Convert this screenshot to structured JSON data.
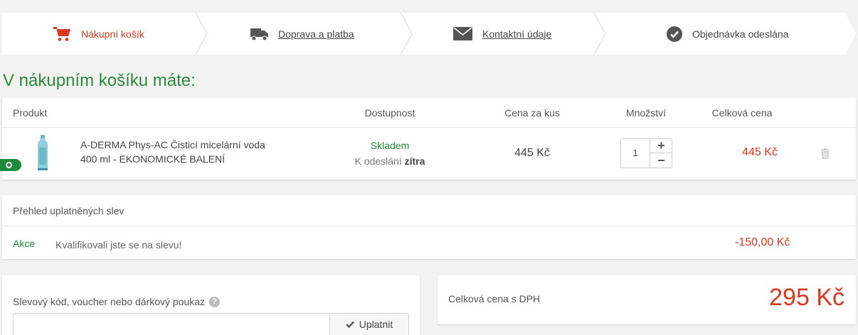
{
  "steps": [
    {
      "label": "Nákupní košík",
      "icon": "cart-icon",
      "active": true
    },
    {
      "label": "Doprava a platba",
      "icon": "truck-icon",
      "active": false
    },
    {
      "label": "Kontaktní údaje",
      "icon": "envelope-icon",
      "active": false
    },
    {
      "label": "Objednávka odeslána",
      "icon": "check-circle-icon",
      "active": false
    }
  ],
  "page_title": "V nákupním košíku máte:",
  "cart": {
    "headers": {
      "product": "Produkt",
      "availability": "Dostupnost",
      "unit_price": "Cena za kus",
      "quantity": "Množství",
      "total": "Celková cena"
    },
    "items": [
      {
        "name": "A-DERMA Phys-AC Čisticí micelární voda 400 ml - EKONOMICKÉ BALENÍ",
        "stock": "Skladem",
        "ship_prefix": "K odeslání",
        "ship_day": "zítra",
        "unit_price": "445 Kč",
        "quantity": "1",
        "total": "445 Kč"
      }
    ]
  },
  "discounts": {
    "title": "Přehled uplatněných slev",
    "items": [
      {
        "label": "Akce",
        "note": "Kvalifikovali jste se na slevu!",
        "amount": "-150,00 Kč"
      }
    ]
  },
  "voucher": {
    "label": "Slevový kód, voucher nebo dárkový poukaz",
    "placeholder": "",
    "button": "Uplatnit"
  },
  "grand_total": {
    "label": "Celková cena s DPH",
    "value": "295 Kč"
  },
  "colors": {
    "accent_red": "#d9381e",
    "accent_green": "#2b8a3e"
  }
}
